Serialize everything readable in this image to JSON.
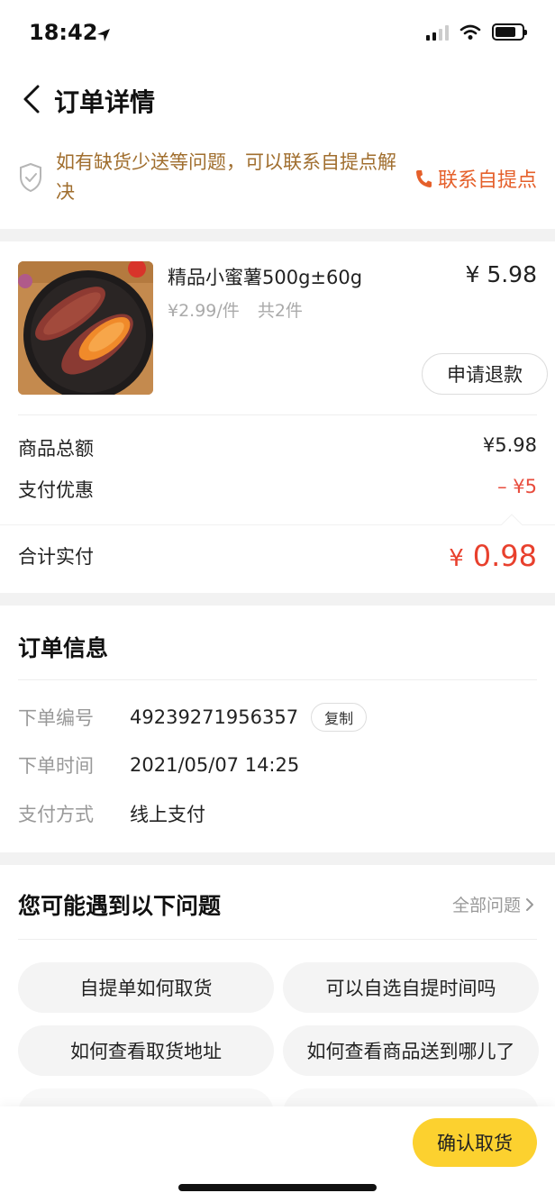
{
  "status_bar": {
    "time": "18:42"
  },
  "nav": {
    "title": "订单详情"
  },
  "notice": {
    "text": "如有缺货少送等问题，可以联系自提点解决",
    "contact_label": "联系自提点"
  },
  "product": {
    "name": "精品小蜜薯500g±60g",
    "price": "¥ 5.98",
    "unit_price": "¥2.99/件",
    "quantity": "共2件",
    "refund_label": "申请退款"
  },
  "summary": {
    "subtotal_label": "商品总额",
    "subtotal_value": "¥5.98",
    "discount_label": "支付优惠",
    "discount_value": "– ¥5",
    "total_label": "合计实付",
    "total_currency": "¥",
    "total_value": "0.98"
  },
  "order_info": {
    "title": "订单信息",
    "rows": [
      {
        "label": "下单编号",
        "value": "49239271956357"
      },
      {
        "label": "下单时间",
        "value": "2021/05/07 14:25"
      },
      {
        "label": "支付方式",
        "value": "线上支付"
      }
    ],
    "copy_label": "复制"
  },
  "faq": {
    "title": "您可能遇到以下问题",
    "all_label": "全部问题",
    "items": [
      "自提单如何取货",
      "可以自选自提时间吗",
      "如何查看取货地址",
      "如何查看商品送到哪儿了"
    ]
  },
  "bottom_bar": {
    "confirm_label": "确认取货"
  },
  "colors": {
    "accent": "#e5602b",
    "price_red": "#e8402d",
    "notice_text": "#a06e2e",
    "confirm_yellow": "#fcd12f"
  }
}
